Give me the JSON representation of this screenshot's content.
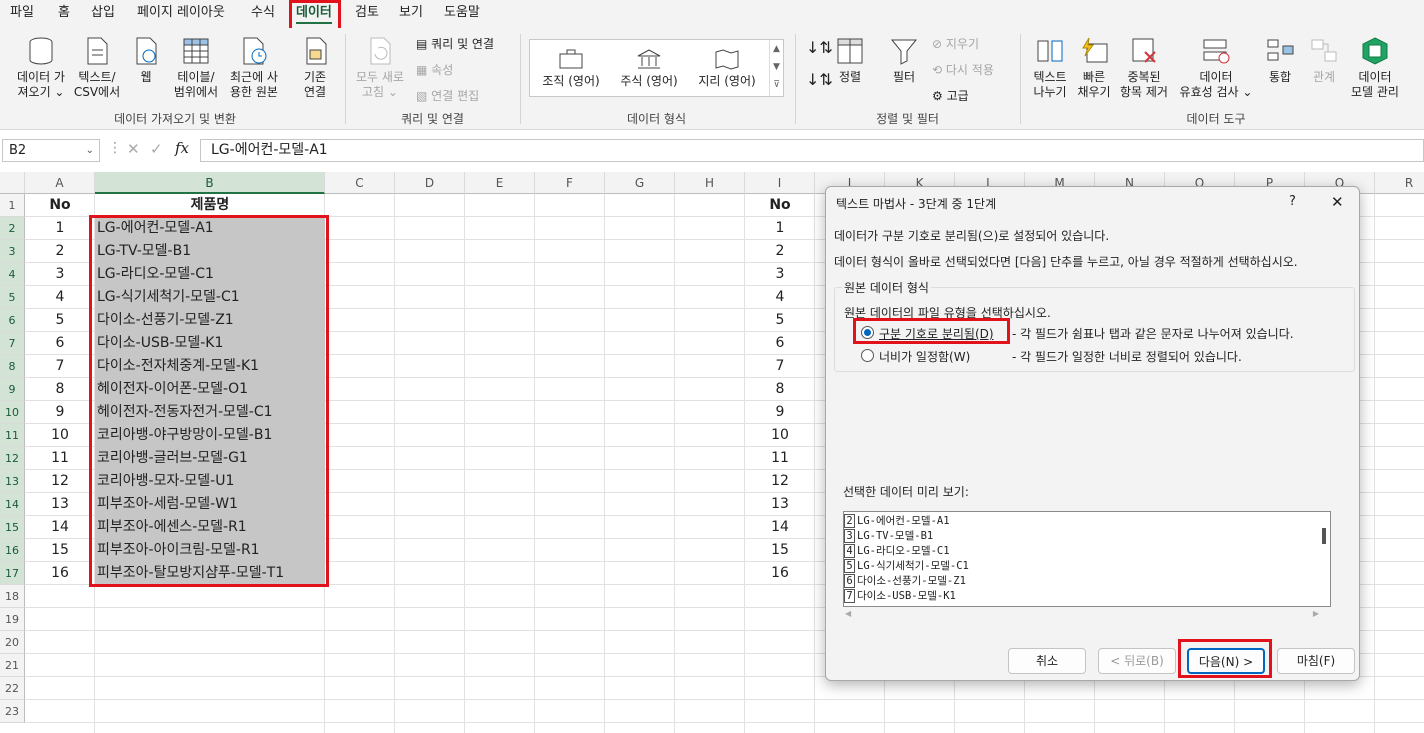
{
  "menu": [
    "파일",
    "홈",
    "삽입",
    "페이지 레이아웃",
    "수식",
    "데이터",
    "검토",
    "보기",
    "도움말"
  ],
  "ribbon": {
    "get_data": "데이터 가",
    "get_data2": "져오기 ⌄",
    "text_csv": "텍스트/",
    "text_csv2": "CSV에서",
    "web": "웹",
    "table": "테이블/",
    "table2": "범위에서",
    "recent": "최근에 사",
    "recent2": "용한 원본",
    "existing": "기존",
    "existing2": "연결",
    "refresh": "모두 새로",
    "refresh2": "고침 ⌄",
    "queries": "쿼리 및 연결",
    "properties": "속성",
    "edit_links": "연결 편집",
    "org": "조직 (영어)",
    "stocks": "주식 (영어)",
    "geo": "지리 (영어)",
    "sort": "정렬",
    "filter": "필터",
    "clear": "지우기",
    "reapply": "다시 적용",
    "advanced": "고급",
    "text_to_cols": "텍스트",
    "text_to_cols2": "나누기",
    "flash": "빠른",
    "flash2": "채우기",
    "dupes": "중복된",
    "dupes2": "항목 제거",
    "validation": "데이터",
    "validation2": "유효성 검사 ⌄",
    "consolidate": "통합",
    "relations": "관계",
    "model": "데이터",
    "model2": "모델 관리",
    "groups": {
      "get": "데이터 가져오기 및 변환",
      "query": "쿼리 및 연결",
      "types": "데이터 형식",
      "sortfilter": "정렬 및 필터",
      "tools": "데이터 도구"
    }
  },
  "formula": {
    "namebox": "B2",
    "fx": "fx",
    "content": "LG-에어컨-모델-A1"
  },
  "columns": [
    "A",
    "B",
    "C",
    "D",
    "E",
    "F",
    "G",
    "H",
    "I",
    "J",
    "K",
    "L",
    "M",
    "N",
    "O",
    "P",
    "Q",
    "R"
  ],
  "rows": [
    "1",
    "2",
    "3",
    "4",
    "5",
    "6",
    "7",
    "8",
    "9",
    "10",
    "11",
    "12",
    "13",
    "14",
    "15",
    "16",
    "17",
    "18",
    "19",
    "20",
    "21",
    "22",
    "23"
  ],
  "header": {
    "no": "No",
    "name": "제품명",
    "no2": "No"
  },
  "numbers": [
    "1",
    "2",
    "3",
    "4",
    "5",
    "6",
    "7",
    "8",
    "9",
    "10",
    "11",
    "12",
    "13",
    "14",
    "15",
    "16"
  ],
  "products": [
    "LG-에어컨-모델-A1",
    "LG-TV-모델-B1",
    "LG-라디오-모델-C1",
    "LG-식기세척기-모델-C1",
    "다이소-선풍기-모델-Z1",
    "다이소-USB-모델-K1",
    "다이소-전자체중계-모델-K1",
    "헤이전자-이어폰-모델-O1",
    "헤이전자-전동자전거-모델-C1",
    "코리아뱅-야구방망이-모델-B1",
    "코리아뱅-글러브-모델-G1",
    "코리아뱅-모자-모델-U1",
    "피부조아-세럼-모델-W1",
    "피부조아-에센스-모델-R1",
    "피부조아-아이크림-모델-R1",
    "피부조아-탈모방지샴푸-모델-T1"
  ],
  "dialog": {
    "title": "텍스트 마법사 - 3단계 중 1단계",
    "help": "?",
    "close": "✕",
    "line1": "데이터가 구분 기호로 분리됨(으)로 설정되어 있습니다.",
    "line2": "데이터 형식이 올바로 선택되었다면 [다음] 단추를 누르고, 아닐 경우 적절하게 선택하십시오.",
    "group_label": "원본 데이터 형식",
    "group_desc": "원본 데이터의 파일 유형을 선택하십시오.",
    "opt1": "구분 기호로 분리됨(D)",
    "opt1_desc": "- 각 필드가 쉼표나 탭과 같은 문자로 나누어져 있습니다.",
    "opt2": "너비가 일정함(W)",
    "opt2_desc": "- 각 필드가 일정한 너비로 정렬되어 있습니다.",
    "preview_label": "선택한 데이터 미리 보기:",
    "preview": [
      {
        "n": "2",
        "t": "LG-에어컨-모델-A1"
      },
      {
        "n": "3",
        "t": "LG-TV-모델-B1"
      },
      {
        "n": "4",
        "t": "LG-라디오-모델-C1"
      },
      {
        "n": "5",
        "t": "LG-식기세척기-모델-C1"
      },
      {
        "n": "6",
        "t": "다이소-선풍기-모델-Z1"
      },
      {
        "n": "7",
        "t": "다이소-USB-모델-K1"
      }
    ],
    "cancel": "취소",
    "back": "< 뒤로(B)",
    "next": "다음(N) >",
    "finish": "마침(F)"
  }
}
